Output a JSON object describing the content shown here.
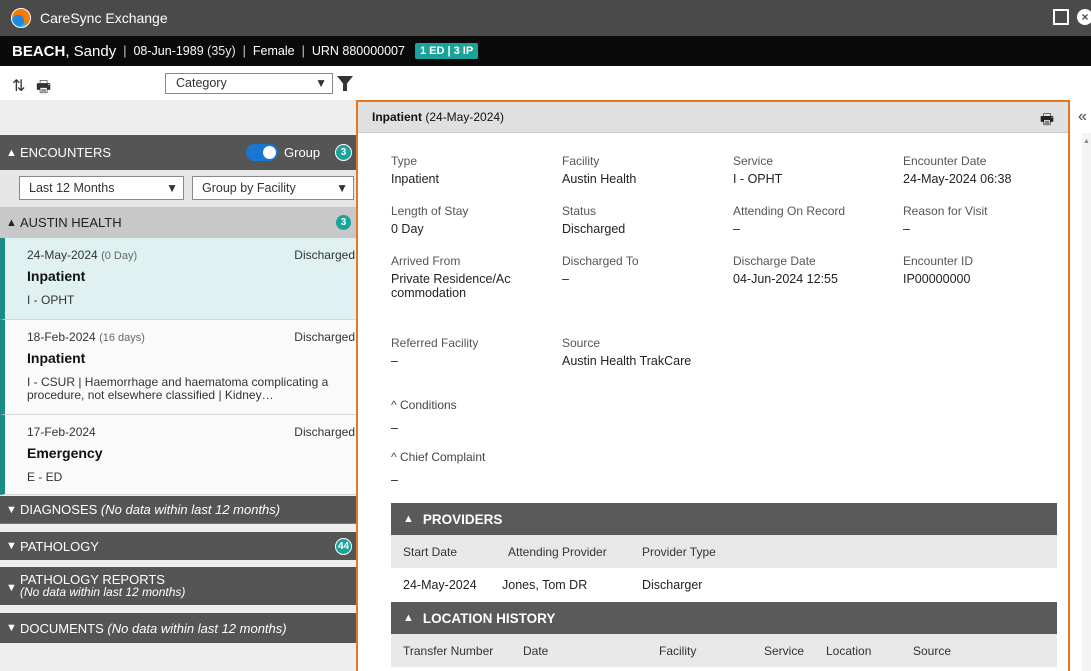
{
  "window": {
    "title": "CareSync Exchange"
  },
  "patient": {
    "surname": "BEACH",
    "given": ", Sandy",
    "dob": "08-Jun-1989",
    "age": "(35y)",
    "sex": "Female",
    "urn": "URN 880000007",
    "badge": "1 ED | 3 IP"
  },
  "toolbar": {
    "category_placeholder": "Category"
  },
  "encounters": {
    "header": "ENCOUNTERS",
    "group_label": "Group",
    "count": "3",
    "period": "Last 12 Months",
    "grouping": "Group by Facility",
    "group": {
      "name": "AUSTIN HEALTH",
      "count": "3"
    },
    "items": [
      {
        "date": "24-May-2024",
        "duration": "(0 Day)",
        "status": "Discharged",
        "type": "Inpatient",
        "service": "I - OPHT"
      },
      {
        "date": "18-Feb-2024",
        "duration": "(16 days)",
        "status": "Discharged",
        "type": "Inpatient",
        "service": "I - CSUR | Haemorrhage and haematoma complicating a procedure, not elsewhere classified | Kidney…"
      },
      {
        "date": "17-Feb-2024",
        "duration": "",
        "status": "Discharged",
        "type": "Emergency",
        "service": "E - ED"
      }
    ]
  },
  "sections": {
    "diagnoses": {
      "label": "DIAGNOSES",
      "note": "(No data within last 12 months)"
    },
    "pathology": {
      "label": "PATHOLOGY",
      "count": "44"
    },
    "pathology_reports": {
      "label": "PATHOLOGY REPORTS",
      "note": "(No data within last 12 months)"
    },
    "documents": {
      "label": "DOCUMENTS",
      "note": "(No data within last 12 months)"
    }
  },
  "detail": {
    "header_type": "Inpatient",
    "header_date": "(24-May-2024)",
    "fields": {
      "type": {
        "label": "Type",
        "value": "Inpatient"
      },
      "facility": {
        "label": "Facility",
        "value": "Austin Health"
      },
      "service": {
        "label": "Service",
        "value": "I - OPHT"
      },
      "encounter_date": {
        "label": "Encounter Date",
        "value": "24-May-2024 06:38"
      },
      "length_of_stay": {
        "label": "Length of Stay",
        "value": "0 Day"
      },
      "status": {
        "label": "Status",
        "value": "Discharged"
      },
      "attending": {
        "label": "Attending On Record",
        "value": "–"
      },
      "reason": {
        "label": "Reason for Visit",
        "value": "–"
      },
      "arrived_from": {
        "label": "Arrived From",
        "value": "Private Residence/Accommodation"
      },
      "discharged_to": {
        "label": "Discharged To",
        "value": "–"
      },
      "discharge_date": {
        "label": "Discharge Date",
        "value": "04-Jun-2024 12:55"
      },
      "encounter_id": {
        "label": "Encounter ID",
        "value": "IP00000000"
      },
      "referred_facility": {
        "label": "Referred Facility",
        "value": "–"
      },
      "source": {
        "label": "Source",
        "value": "Austin Health TrakCare"
      }
    },
    "conditions": {
      "label": "Conditions",
      "value": "–"
    },
    "chief_complaint": {
      "label": "Chief Complaint",
      "value": "–"
    },
    "providers": {
      "label": "PROVIDERS",
      "columns": [
        "Start Date",
        "Attending Provider",
        "Provider Type"
      ],
      "rows": [
        [
          "24-May-2024",
          "Jones, Tom DR",
          "Discharger"
        ]
      ]
    },
    "location_history": {
      "label": "LOCATION HISTORY",
      "columns": [
        "Transfer Number",
        "Date",
        "Facility",
        "Service",
        "Location",
        "Source"
      ]
    }
  }
}
